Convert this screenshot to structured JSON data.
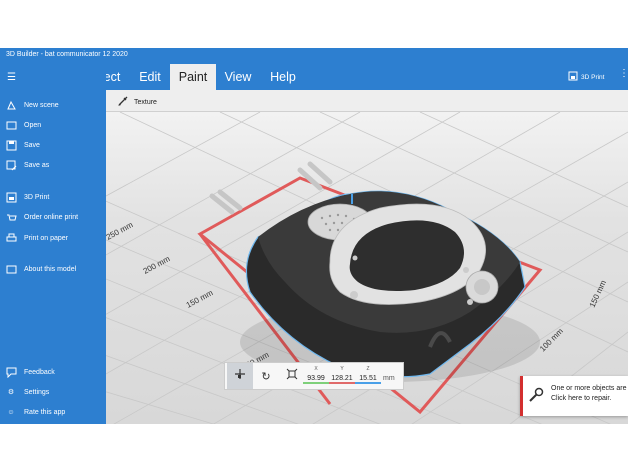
{
  "window": {
    "title": "3D Builder - bat communicator 12 2020"
  },
  "ribbon": {
    "tabs": [
      {
        "label": "ect"
      },
      {
        "label": "Edit"
      },
      {
        "label": "Paint"
      },
      {
        "label": "View"
      },
      {
        "label": "Help"
      }
    ],
    "active_tab": "Paint",
    "print_label": "3D Print",
    "more_icon": "more-icon"
  },
  "toolbar": {
    "texture_label": "Texture"
  },
  "sidebar": {
    "menu_icon": "hamburger-icon",
    "items": [
      {
        "label": "New scene",
        "icon": "new-scene-icon"
      },
      {
        "label": "Open",
        "icon": "open-icon"
      },
      {
        "label": "Save",
        "icon": "save-icon"
      },
      {
        "label": "Save as",
        "icon": "save-as-icon"
      },
      {
        "label": "3D Print",
        "icon": "print-3d-icon"
      },
      {
        "label": "Order online print",
        "icon": "order-print-icon"
      },
      {
        "label": "Print on paper",
        "icon": "printer-icon"
      },
      {
        "label": "About this model",
        "icon": "info-icon"
      },
      {
        "label": "Feedback",
        "icon": "feedback-icon"
      },
      {
        "label": "Settings",
        "icon": "gear-icon"
      },
      {
        "label": "Rate this app",
        "icon": "smiley-icon"
      }
    ]
  },
  "viewport": {
    "axis_labels": [
      "250 mm",
      "200 mm",
      "150 mm",
      "100 mm",
      "150 mm",
      "100 mm"
    ]
  },
  "coords": {
    "x_label": "X",
    "y_label": "Y",
    "z_label": "Z",
    "x_value": "93.99",
    "y_value": "128.21",
    "z_value": "15.51",
    "unit": "mm",
    "colors": {
      "x": "#7ed07a",
      "y": "#e06a6a",
      "z": "#4aa0e8"
    }
  },
  "notification": {
    "line1": "One or more objects are",
    "line2": "Click here to repair.",
    "accent": "#d32f2f"
  },
  "theme": {
    "accent": "#2d7fd0",
    "ribbon_active_bg": "#eeeeee",
    "bound_box": "#e05a5a"
  }
}
